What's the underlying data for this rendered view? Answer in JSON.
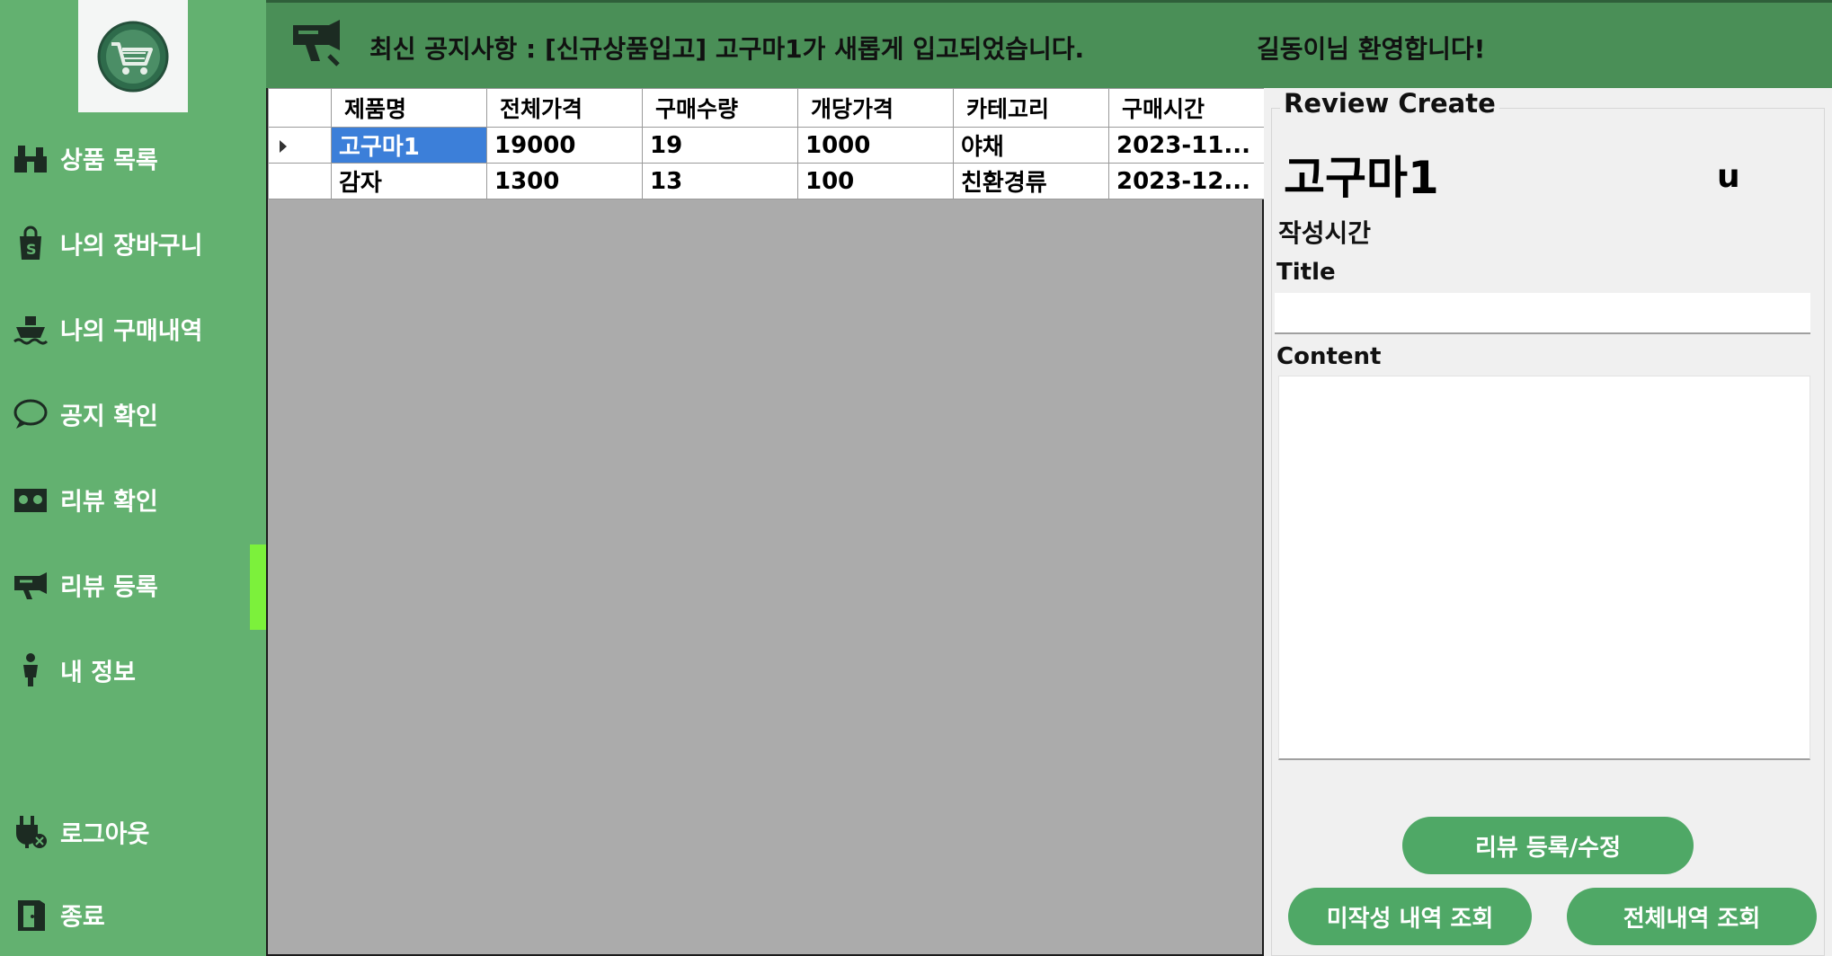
{
  "header": {
    "notice": "최신 공지사항 : [신규상품입고] 고구마1가 새롭게 입고되었습니다.",
    "welcome": "길동이님 환영합니다!"
  },
  "sidebar": {
    "items": [
      {
        "label": "상품 목록",
        "icon": "store-icon"
      },
      {
        "label": "나의 장바구니",
        "icon": "shopping-bag-icon"
      },
      {
        "label": "나의 구매내역",
        "icon": "ship-icon"
      },
      {
        "label": "공지 확인",
        "icon": "chat-bubble-icon"
      },
      {
        "label": "리뷰 확인",
        "icon": "review-icon"
      },
      {
        "label": "리뷰 등록",
        "icon": "megaphone-icon"
      },
      {
        "label": "내 정보",
        "icon": "person-icon"
      },
      {
        "label": "로그아웃",
        "icon": "plug-x-icon"
      },
      {
        "label": "종료",
        "icon": "exit-door-icon"
      }
    ],
    "active": "리뷰 등록"
  },
  "grid": {
    "columns": [
      "제품명",
      "전체가격",
      "구매수량",
      "개당가격",
      "카테고리",
      "구매시간"
    ],
    "rows": [
      [
        "고구마1",
        "19000",
        "19",
        "1000",
        "야채",
        "2023-11..."
      ],
      [
        "감자",
        "1300",
        "13",
        "100",
        "친환경류",
        "2023-12..."
      ]
    ],
    "selected_row": 0
  },
  "review": {
    "legend": "Review Create",
    "product_name": "고구마1",
    "user_id": "u",
    "written_time_label": "작성시간",
    "title_label": "Title",
    "title_value": "",
    "content_label": "Content",
    "content_value": ""
  },
  "buttons": {
    "register": "리뷰 등록/수정",
    "unwritten": "미작성 내역 조회",
    "all": "전체내역 조회"
  },
  "colors": {
    "sidebar": "#63b170",
    "header": "#4a8f57",
    "active_indicator": "#7cf13b",
    "button": "#4fa866",
    "selection": "#3c7fd9"
  }
}
